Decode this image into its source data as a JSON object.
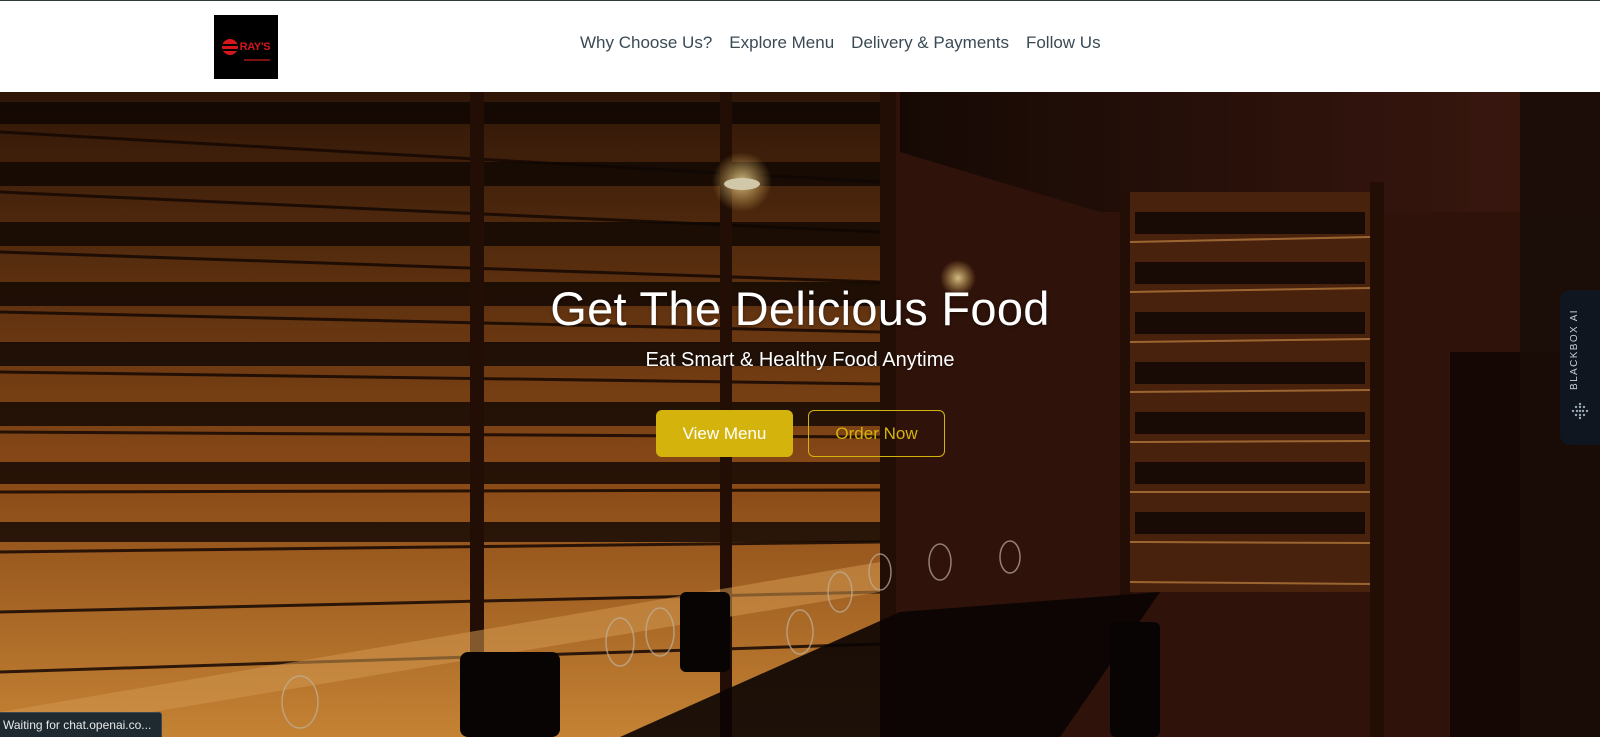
{
  "header": {
    "logo": {
      "brand_text": "RAY'S",
      "icon": "ray-logo-icon",
      "colors": {
        "background": "#000000",
        "mark": "#d4161d"
      }
    },
    "nav": [
      {
        "label": "Why Choose Us?"
      },
      {
        "label": "Explore Menu"
      },
      {
        "label": "Delivery & Payments"
      },
      {
        "label": "Follow Us"
      }
    ]
  },
  "hero": {
    "title": "Get The Delicious Food",
    "subtitle": "Eat Smart & Healthy Food Anytime",
    "view_menu_label": "View Menu",
    "order_now_label": "Order Now",
    "accent_color": "#d4b40c"
  },
  "sidebar_widget": {
    "label": "BLACKBOX AI",
    "icon": "blackbox-dots-icon"
  },
  "statusbar": {
    "text": "Waiting for chat.openai.co..."
  }
}
